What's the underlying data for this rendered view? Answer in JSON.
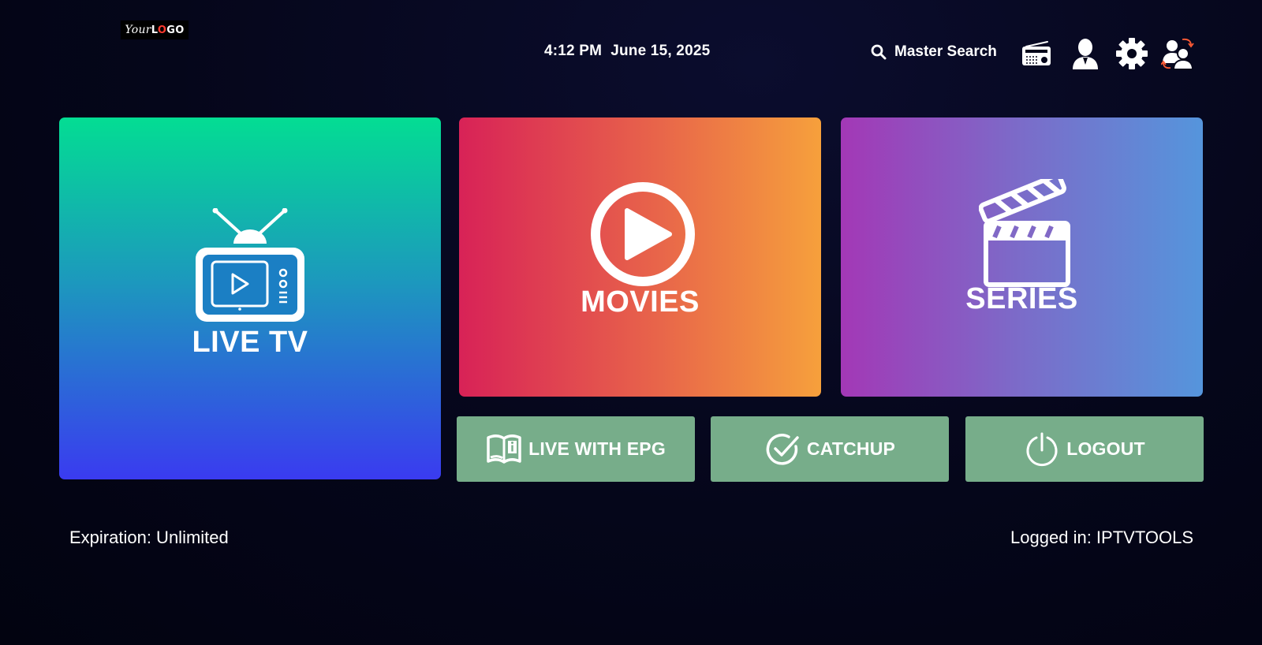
{
  "header": {
    "logo": {
      "part1": "Your",
      "part2a": "L",
      "part2b": "O",
      "part2c": "GO"
    },
    "time": "4:12 PM",
    "date": "June 15, 2025",
    "search_label": "Master Search"
  },
  "tiles": {
    "live_tv": "LIVE TV",
    "movies": "MOVIES",
    "series": "SERIES"
  },
  "buttons": {
    "live_epg": "LIVE WITH EPG",
    "catchup": "CATCHUP",
    "logout": "LOGOUT"
  },
  "footer": {
    "expiration": "Expiration: Unlimited",
    "logged_in": "Logged in: IPTVTOOLS"
  },
  "colors": {
    "button_bg": "#77ad8a",
    "live_gradient_top": "#03dd93",
    "live_gradient_bottom": "#3a3bf0",
    "movies_gradient_left": "#d82257",
    "movies_gradient_right": "#f6a03c",
    "series_gradient_left": "#a338b6",
    "series_gradient_right": "#5595dc",
    "logo_accent": "#ff3b2f"
  },
  "icons": [
    "search-icon",
    "radio-icon",
    "user-icon",
    "gear-icon",
    "switch-users-icon",
    "tv-icon",
    "play-icon",
    "clapperboard-icon",
    "book-info-icon",
    "check-circle-icon",
    "power-icon"
  ]
}
